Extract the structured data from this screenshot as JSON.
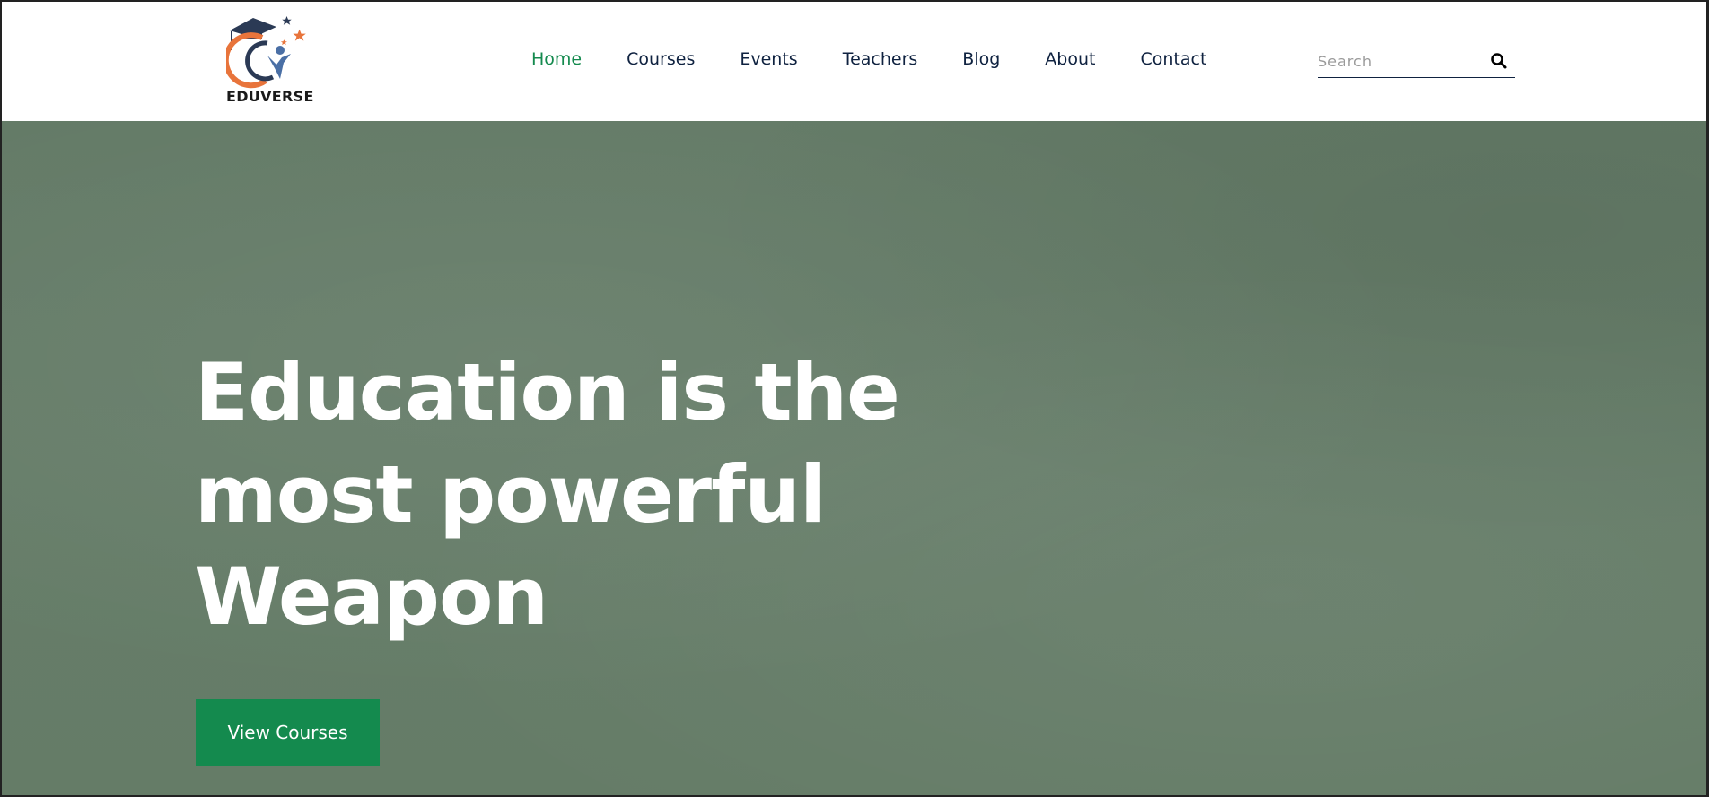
{
  "brand": {
    "name": "EDUVERSE"
  },
  "nav": {
    "items": [
      {
        "label": "Home",
        "active": true
      },
      {
        "label": "Courses",
        "active": false
      },
      {
        "label": "Events",
        "active": false
      },
      {
        "label": "Teachers",
        "active": false
      },
      {
        "label": "Blog",
        "active": false
      },
      {
        "label": "About",
        "active": false
      },
      {
        "label": "Contact",
        "active": false
      }
    ]
  },
  "search": {
    "placeholder": "Search",
    "value": "",
    "icon": "search-icon"
  },
  "hero": {
    "title_lines": [
      "Education is the",
      "most powerful",
      "Weapon"
    ],
    "cta_label": "View Courses"
  },
  "colors": {
    "accent": "#148a4e",
    "nav_text": "#0f2240",
    "hero_bg": "#657c67",
    "logo_orange": "#e8743b",
    "logo_navy": "#2b3a55"
  }
}
